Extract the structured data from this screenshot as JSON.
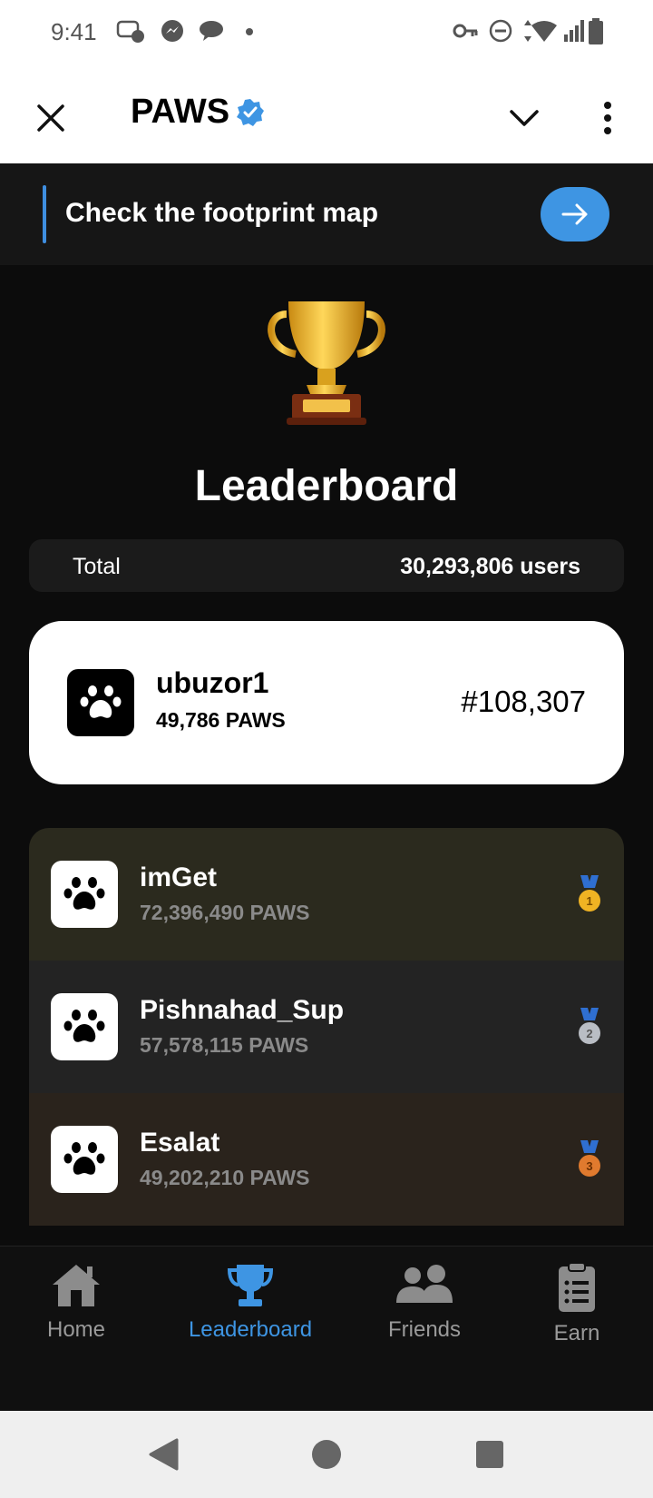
{
  "status_bar": {
    "time": "9:41"
  },
  "header": {
    "title": "PAWS"
  },
  "banner": {
    "text": "Check the footprint map"
  },
  "leaderboard": {
    "title": "Leaderboard"
  },
  "total": {
    "label": "Total",
    "value": "30,293,806 users"
  },
  "me": {
    "name": "ubuzor1",
    "paws": "49,786 PAWS",
    "rank": "#108,307"
  },
  "rows": [
    {
      "name": "imGet",
      "paws": "72,396,490 PAWS",
      "medal": "1",
      "bg": "#2b2a1e",
      "medal_color": "#f0b323"
    },
    {
      "name": "Pishnahad_Sup",
      "paws": "57,578,115 PAWS",
      "medal": "2",
      "bg": "#232323",
      "medal_color": "#b9bdc4"
    },
    {
      "name": "Esalat",
      "paws": "49,202,210 PAWS",
      "medal": "3",
      "bg": "#2a231c",
      "medal_color": "#e07a2e"
    }
  ],
  "nav": [
    {
      "label": "Home"
    },
    {
      "label": "Leaderboard"
    },
    {
      "label": "Friends"
    },
    {
      "label": "Earn"
    }
  ],
  "colors": {
    "accent": "#3e95e3",
    "background": "#0c0c0c"
  }
}
